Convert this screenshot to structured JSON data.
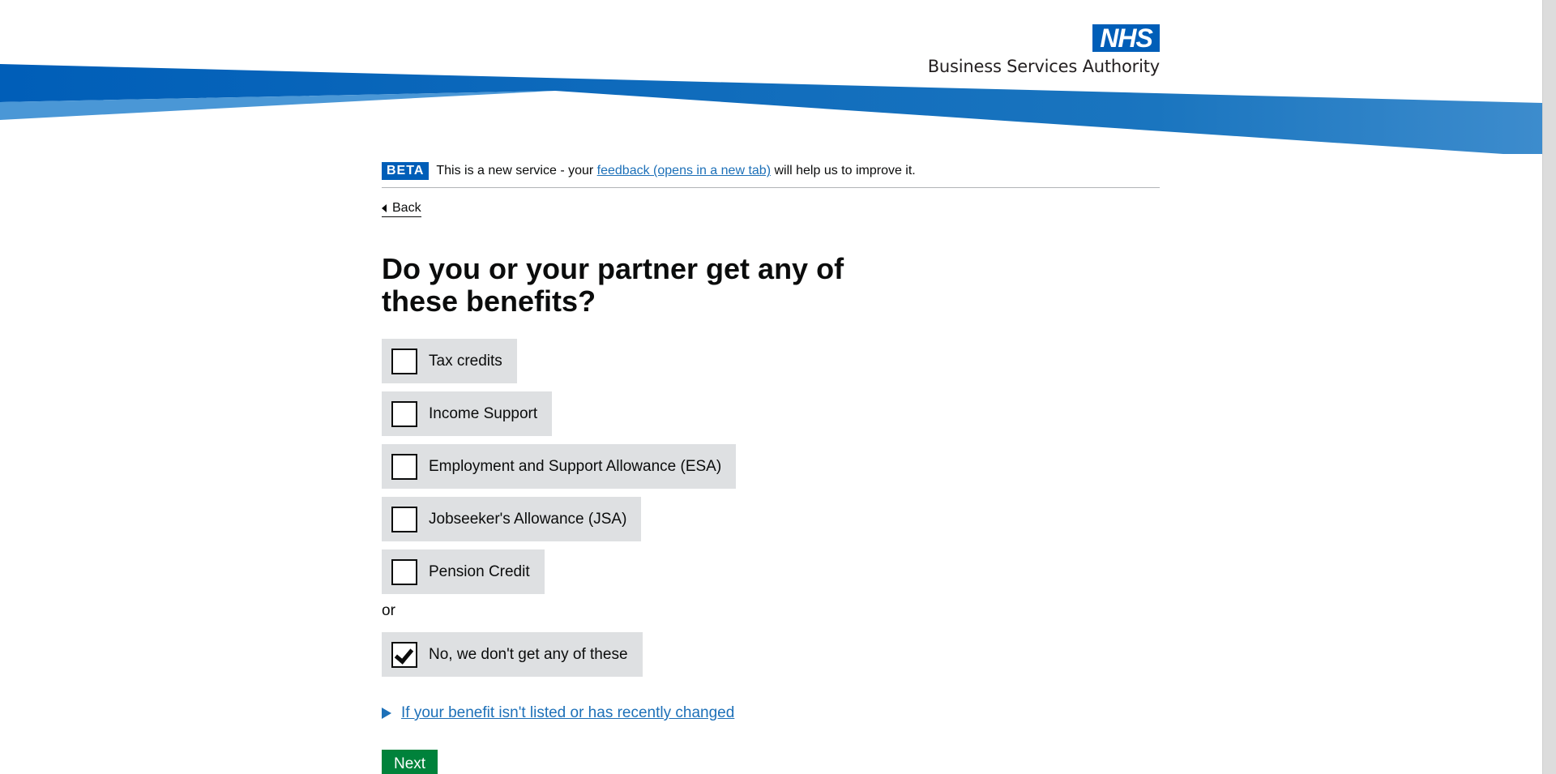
{
  "header": {
    "logo_mark": "NHS",
    "org_name": "Business Services Authority"
  },
  "beta_banner": {
    "tag": "BETA",
    "text_before": "This is a new service - your ",
    "link_text": "feedback (opens in a new tab)",
    "text_after": " will help us to improve it."
  },
  "back_link": {
    "label": "Back"
  },
  "question": {
    "title": "Do you or your partner get any of these benefits?"
  },
  "options": [
    {
      "label": "Tax credits",
      "checked": false
    },
    {
      "label": "Income Support",
      "checked": false
    },
    {
      "label": "Employment and Support Allowance (ESA)",
      "checked": false
    },
    {
      "label": "Jobseeker's Allowance (JSA)",
      "checked": false
    },
    {
      "label": "Pension Credit",
      "checked": false
    }
  ],
  "separator": "or",
  "none_option": {
    "label": "No, we don't get any of these",
    "checked": true
  },
  "details": {
    "summary": "If your benefit isn't listed or has recently changed"
  },
  "next_button": {
    "label": "Next"
  },
  "colors": {
    "nhs_blue": "#005eb8",
    "link_blue": "#1d70b8",
    "button_green": "#00823b",
    "option_grey": "#dee0e2"
  }
}
